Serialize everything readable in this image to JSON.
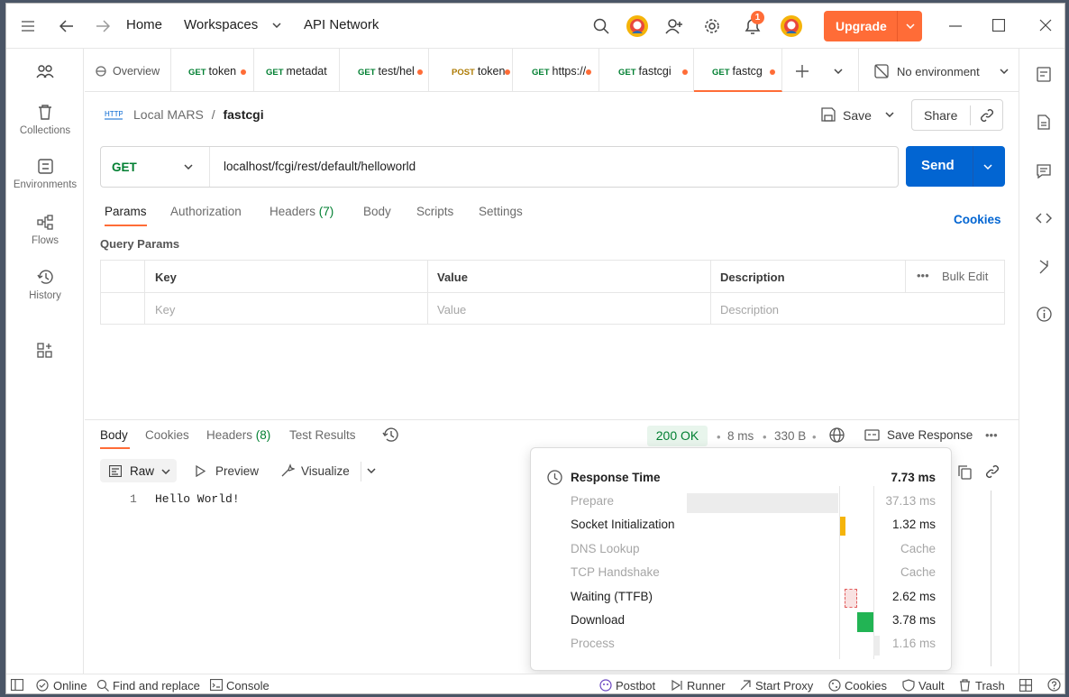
{
  "nav": {
    "home": "Home",
    "workspaces": "Workspaces",
    "api_network": "API Network",
    "notification_count": "1",
    "upgrade": "Upgrade"
  },
  "sidebar": {
    "items": [
      {
        "label": "Collections",
        "icon": "trash-icon"
      },
      {
        "label": "Environments",
        "icon": "environment-icon"
      },
      {
        "label": "Flows",
        "icon": "flows-icon"
      },
      {
        "label": "History",
        "icon": "history-icon"
      }
    ]
  },
  "tabs": [
    {
      "method": "",
      "label": "Overview",
      "dot": false
    },
    {
      "method": "GET",
      "label": "token",
      "dot": true
    },
    {
      "method": "GET",
      "label": "metadat",
      "dot": false
    },
    {
      "method": "GET",
      "label": "test/hel",
      "dot": true
    },
    {
      "method": "POST",
      "label": "token",
      "dot": true
    },
    {
      "method": "GET",
      "label": "https://",
      "dot": true
    },
    {
      "method": "GET",
      "label": "fastcgi",
      "dot": true
    },
    {
      "method": "GET",
      "label": "fastcg",
      "dot": true
    }
  ],
  "environment": "No environment",
  "breadcrumb": {
    "collection": "Local MARS",
    "separator": "/",
    "request": "fastcgi"
  },
  "actions": {
    "save": "Save",
    "share": "Share"
  },
  "request": {
    "method": "GET",
    "url": "localhost/fcgi/rest/default/helloworld",
    "send": "Send"
  },
  "request_tabs": {
    "params": "Params",
    "authorization": "Authorization",
    "headers": "Headers",
    "headers_count": "(7)",
    "body": "Body",
    "scripts": "Scripts",
    "settings": "Settings",
    "cookies": "Cookies"
  },
  "query_params": {
    "title": "Query Params",
    "columns": [
      "Key",
      "Value",
      "Description"
    ],
    "bulk_edit": "Bulk Edit",
    "placeholders": [
      "Key",
      "Value",
      "Description"
    ]
  },
  "response": {
    "tabs": {
      "body": "Body",
      "cookies": "Cookies",
      "headers": "Headers",
      "headers_count": "(8)",
      "test_results": "Test Results"
    },
    "status": "200 OK",
    "time": "8 ms",
    "size": "330 B",
    "save_response": "Save Response",
    "view_modes": {
      "raw": "Raw",
      "preview": "Preview",
      "visualize": "Visualize"
    },
    "line_number": "1",
    "body_text": "Hello World!"
  },
  "response_time": {
    "title": "Response Time",
    "total": "7.73 ms",
    "rows": [
      {
        "name": "Prepare",
        "value": "37.13 ms",
        "dim": true
      },
      {
        "name": "Socket Initialization",
        "value": "1.32 ms",
        "dim": false
      },
      {
        "name": "DNS Lookup",
        "value": "Cache",
        "dim": true
      },
      {
        "name": "TCP Handshake",
        "value": "Cache",
        "dim": true
      },
      {
        "name": "Waiting (TTFB)",
        "value": "2.62 ms",
        "dim": false
      },
      {
        "name": "Download",
        "value": "3.78 ms",
        "dim": false
      },
      {
        "name": "Process",
        "value": "1.16 ms",
        "dim": true
      }
    ]
  },
  "statusbar": {
    "online": "Online",
    "find_replace": "Find and replace",
    "console": "Console",
    "postbot": "Postbot",
    "runner": "Runner",
    "start_proxy": "Start Proxy",
    "cookies": "Cookies",
    "vault": "Vault",
    "trash": "Trash"
  },
  "colors": {
    "accent_orange": "#ff6c37",
    "send_blue": "#0265d2",
    "get_green": "#007f31",
    "post_amber": "#ad7a03",
    "socket_bar": "#f5b40a",
    "download_bar": "#22b454"
  }
}
